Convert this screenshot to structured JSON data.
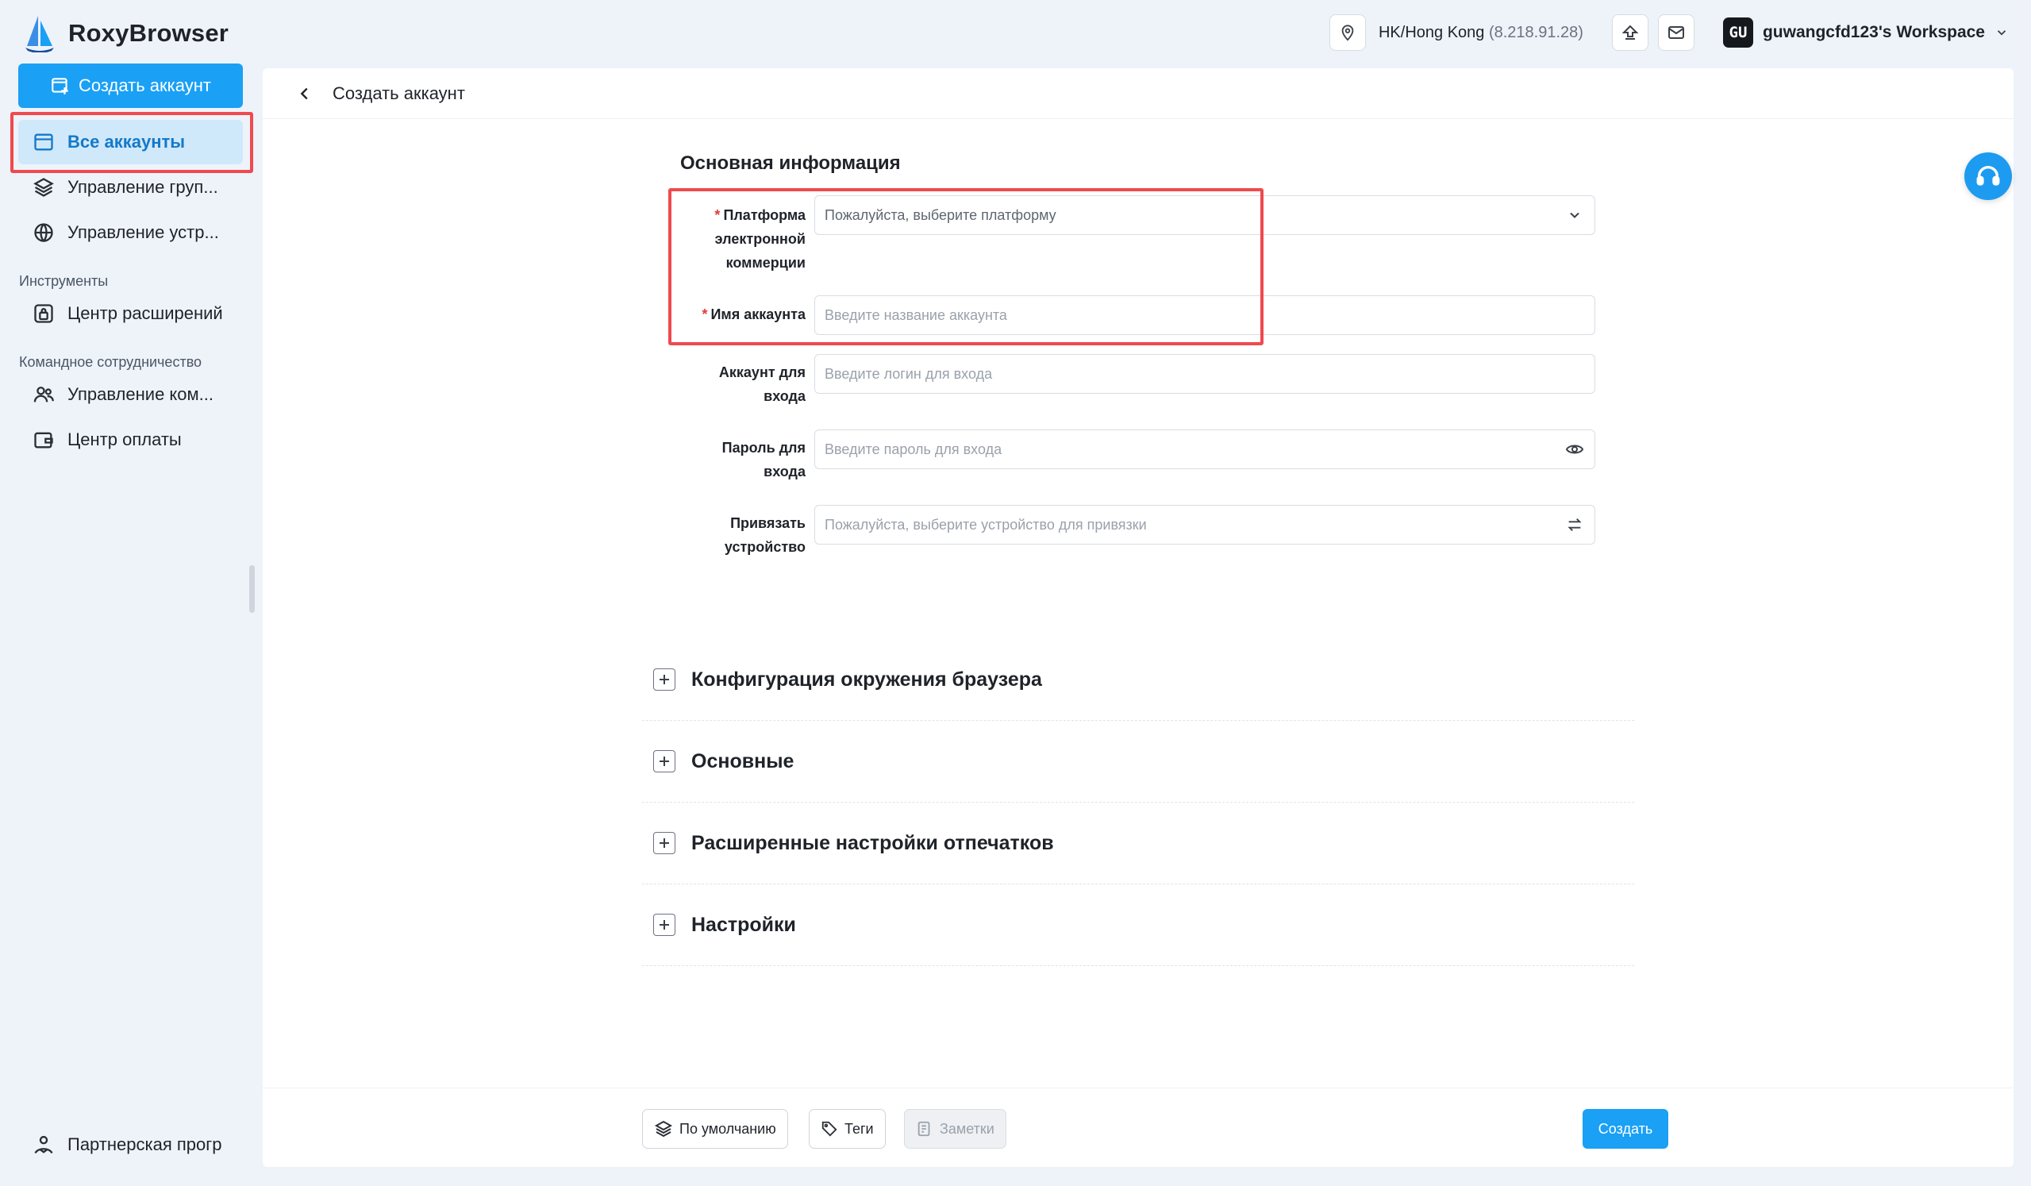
{
  "brand": {
    "name": "RoxyBrowser"
  },
  "topbar": {
    "location_name": "HK/Hong Kong",
    "location_ip": "(8.218.91.28)",
    "workspace_initials": "GU",
    "workspace_name": "guwangcfd123's Workspace"
  },
  "sidebar": {
    "create_label": "Создать аккаунт",
    "items": [
      {
        "label": "Все аккаунты",
        "icon": "window-icon"
      },
      {
        "label": "Управление груп...",
        "icon": "layers-icon"
      },
      {
        "label": "Управление устр...",
        "icon": "globe-icon"
      }
    ],
    "tools_section": "Инструменты",
    "tools_items": [
      {
        "label": "Центр расширений",
        "icon": "extension-icon"
      }
    ],
    "team_section": "Командное сотрудничество",
    "team_items": [
      {
        "label": "Управление ком...",
        "icon": "users-icon"
      },
      {
        "label": "Центр оплаты",
        "icon": "wallet-icon"
      }
    ],
    "partner_label": "Партнерская прогр"
  },
  "page": {
    "title": "Создать аккаунт",
    "section_title": "Основная информация",
    "form": {
      "platform": {
        "label_lines": [
          "Платформа",
          "электронной",
          "коммерции"
        ],
        "placeholder": "Пожалуйста, выберите платформу",
        "required": true
      },
      "account_name": {
        "label": "Имя аккаунта",
        "placeholder": "Введите название аккаунта",
        "required": true
      },
      "login": {
        "label_lines": [
          "Аккаунт для",
          "входа"
        ],
        "placeholder": "Введите логин для входа"
      },
      "password": {
        "label_lines": [
          "Пароль для",
          "входа"
        ],
        "placeholder": "Введите пароль для входа"
      },
      "device": {
        "label_lines": [
          "Привязать",
          "устройство"
        ],
        "placeholder": "Пожалуйста, выберите устройство для привязки"
      }
    },
    "collapsibles": [
      "Конфигурация окружения браузера",
      "Основные",
      "Расширенные настройки отпечатков",
      "Настройки"
    ],
    "footer": {
      "default_label": "По умолчанию",
      "tags_label": "Теги",
      "notes_label": "Заметки",
      "create_label": "Создать"
    }
  },
  "colors": {
    "accent": "#1aa0f5",
    "highlight": "#ef4a4e",
    "active_bg": "#cfe9fb"
  }
}
